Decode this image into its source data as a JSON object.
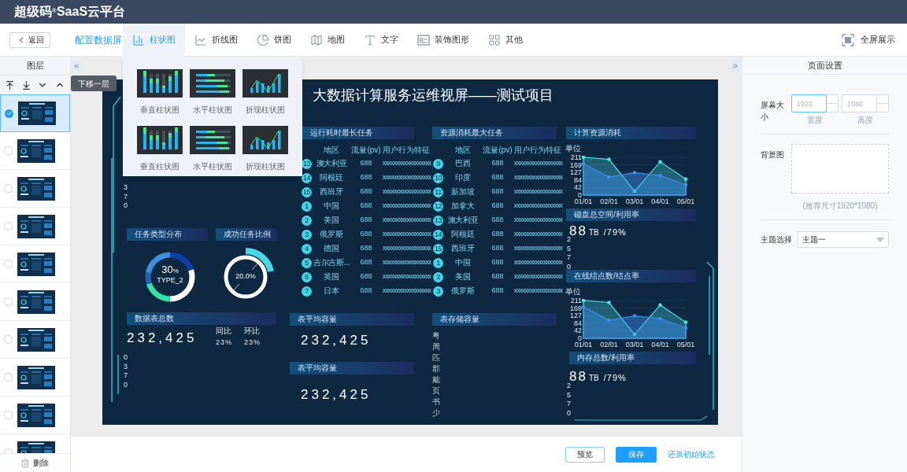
{
  "header": {
    "title": "超级码$^{®}$SaaS云平台"
  },
  "toolbar": {
    "back": "返回",
    "config_link": "配置数据屏",
    "fullscreen": "全屏展示",
    "tabs": [
      {
        "kind": "bar",
        "label": "柱状图",
        "selected": true
      },
      {
        "kind": "line",
        "label": "折线图",
        "selected": false
      },
      {
        "kind": "pie",
        "label": "饼图",
        "selected": false
      },
      {
        "kind": "map",
        "label": "地图",
        "selected": false
      },
      {
        "kind": "text",
        "label": "文字",
        "selected": false
      },
      {
        "kind": "decor",
        "label": "装饰图形",
        "selected": false
      },
      {
        "kind": "other",
        "label": "其他",
        "selected": false
      }
    ]
  },
  "chart_menu": {
    "items": [
      {
        "kind": "vertical",
        "label": "垂直柱状图"
      },
      {
        "kind": "horizontal",
        "label": "水平柱状图"
      },
      {
        "kind": "combo",
        "label": "折现柱状图"
      },
      {
        "kind": "vertical",
        "label": "垂直柱状图"
      },
      {
        "kind": "horizontal",
        "label": "水平柱状图"
      },
      {
        "kind": "combo",
        "label": "折现柱状图"
      }
    ]
  },
  "layers": {
    "title": "图层",
    "tooltip": "下移一层",
    "delete": "删除",
    "items": [
      {
        "selected": true
      },
      {
        "selected": false
      },
      {
        "selected": false
      },
      {
        "selected": false
      },
      {
        "selected": false
      },
      {
        "selected": false
      },
      {
        "selected": false
      },
      {
        "selected": false
      },
      {
        "selected": false
      },
      {
        "selected": false
      }
    ]
  },
  "dashboard": {
    "title": "大数据计算服务运维视屏——测试项目",
    "top_axis_fragments": [
      "3",
      "7",
      "0"
    ],
    "lower_axis_fragments": [
      "0",
      "3",
      "7",
      "0"
    ],
    "task_type": {
      "title": "任务类型分布",
      "value": "30",
      "unit": "%",
      "label": "TYPE_2"
    },
    "success": {
      "title": "成功任务比例",
      "value": "20.0%"
    },
    "total": {
      "title": "数据表总数",
      "value": "232,425",
      "stats": [
        {
          "label": "同比",
          "value": "23%"
        },
        {
          "label": "环比",
          "value": "23%"
        }
      ]
    },
    "tables": [
      {
        "title": "运行耗时最长任务",
        "columns": [
          "地区",
          "流量(pv)",
          "用户行为特征"
        ],
        "rows": [
          {
            "rank": "13",
            "region": "澳大利亚",
            "pv": "688",
            "feature": "xxxxxxxxxxxxxxxxxx"
          },
          {
            "rank": "14",
            "region": "阿根廷",
            "pv": "688",
            "feature": "xxxxxxxxxxxxxxxxxx"
          },
          {
            "rank": "15",
            "region": "西班牙",
            "pv": "688",
            "feature": "xxxxxxxxxxxxxxxxxx"
          },
          {
            "rank": "1",
            "region": "中国",
            "pv": "688",
            "feature": "xxxxxxxxxxxxxxxxxx"
          },
          {
            "rank": "2",
            "region": "美国",
            "pv": "688",
            "feature": "xxxxxxxxxxxxxxxxxx"
          },
          {
            "rank": "3",
            "region": "俄罗斯",
            "pv": "688",
            "feature": "xxxxxxxxxxxxxxxxxx"
          },
          {
            "rank": "4",
            "region": "德国",
            "pv": "688",
            "feature": "xxxxxxxxxxxxxxxxxx"
          },
          {
            "rank": "5",
            "region": "吉尔吉斯...",
            "pv": "688",
            "feature": "xxxxxxxxxxxxxxxxxx"
          },
          {
            "rank": "6",
            "region": "英国",
            "pv": "688",
            "feature": "xxxxxxxxxxxxxxxxxx"
          },
          {
            "rank": "7",
            "region": "日本",
            "pv": "688",
            "feature": "xxxxxxxxxxxxxxxxxx"
          }
        ]
      },
      {
        "title": "资源消耗最大任务",
        "columns": [
          "地区",
          "流量(pv)",
          "用户行为特征"
        ],
        "rows": [
          {
            "rank": "9",
            "region": "巴西",
            "pv": "688",
            "feature": "xxxxxxxxxxxxxxxxxx"
          },
          {
            "rank": "10",
            "region": "印度",
            "pv": "688",
            "feature": "xxxxxxxxxxxxxxxxxx"
          },
          {
            "rank": "11",
            "region": "新加坡",
            "pv": "688",
            "feature": "xxxxxxxxxxxxxxxxxx"
          },
          {
            "rank": "12",
            "region": "加拿大",
            "pv": "688",
            "feature": "xxxxxxxxxxxxxxxxxx"
          },
          {
            "rank": "13",
            "region": "澳大利亚",
            "pv": "688",
            "feature": "xxxxxxxxxxxxxxxxxx"
          },
          {
            "rank": "14",
            "region": "阿根廷",
            "pv": "688",
            "feature": "xxxxxxxxxxxxxxxxxx"
          },
          {
            "rank": "15",
            "region": "西班牙",
            "pv": "688",
            "feature": "xxxxxxxxxxxxxxxxxx"
          },
          {
            "rank": "1",
            "region": "中国",
            "pv": "688",
            "feature": "xxxxxxxxxxxxxxxxxx"
          },
          {
            "rank": "2",
            "region": "美国",
            "pv": "688",
            "feature": "xxxxxxxxxxxxxxxxxx"
          },
          {
            "rank": "3",
            "region": "俄罗斯",
            "pv": "688",
            "feature": "xxxxxxxxxxxxxxxxxx"
          }
        ]
      }
    ],
    "averages": [
      {
        "title": "表平均容量",
        "value": "232,425"
      },
      {
        "title": "表平均容量",
        "value": "232,425"
      }
    ],
    "storage": {
      "title": "表存储容量",
      "labels": [
        "粤",
        "周",
        "匹",
        "郡",
        "戴",
        "页",
        "书",
        "少"
      ]
    },
    "resource": {
      "title": "计算资源消耗",
      "chart_data": {
        "type": "area",
        "grid": true,
        "ylabel": "单位",
        "x": [
          "01/01",
          "02/01",
          "03/01",
          "04/01",
          "05/01"
        ],
        "ylim": [
          0,
          211
        ],
        "yticks": [
          0,
          42,
          84,
          127,
          169,
          211
        ],
        "series": [
          {
            "color": "#4fe3e6",
            "values": [
              211,
              200,
              22,
              186,
              90
            ]
          },
          {
            "color": "#3a8ff0",
            "values": [
              176,
              101,
              125,
              110,
              58
            ]
          }
        ]
      }
    },
    "disk": {
      "title": "磁盘总空间/利用率",
      "value": "88",
      "unit": "TB",
      "ratio": "/79%",
      "axis_fragments": [
        "2",
        "5",
        "7",
        "0"
      ]
    },
    "nodes": {
      "title": "在线结点数/结点率",
      "chart_data": {
        "type": "area",
        "grid": true,
        "ylabel": "单位",
        "x": [
          "01/01",
          "02/01",
          "03/01",
          "04/01",
          "05/01"
        ],
        "ylim": [
          0,
          211
        ],
        "yticks": [
          0,
          42,
          84,
          127,
          169,
          211
        ],
        "series": [
          {
            "color": "#4fe3e6",
            "values": [
              211,
              200,
              22,
              186,
              90
            ]
          },
          {
            "color": "#3a8ff0",
            "values": [
              176,
              101,
              125,
              110,
              58
            ]
          }
        ]
      }
    },
    "memory": {
      "title": "内存总数/利用率",
      "value": "88",
      "unit": "TB",
      "ratio": "/79%",
      "axis_fragments": [
        "2",
        "5",
        "7",
        "0"
      ]
    }
  },
  "right_panel": {
    "title": "页面设置",
    "screen_size": {
      "label": "屏幕大小",
      "fields": [
        {
          "placeholder": "1920",
          "caption": "宽度",
          "focused": true
        },
        {
          "placeholder": "1080",
          "caption": "高度",
          "focused": false
        }
      ]
    },
    "background": {
      "label": "背景图",
      "hint": "(推荐尺寸1920*1080)"
    },
    "theme": {
      "label": "主题选择",
      "value": "主题一"
    }
  },
  "footer": {
    "buttons": [
      {
        "kind": "outline",
        "label": "预览"
      },
      {
        "kind": "primary",
        "label": "保存"
      },
      {
        "kind": "link",
        "label": "还原初始状态"
      }
    ]
  }
}
